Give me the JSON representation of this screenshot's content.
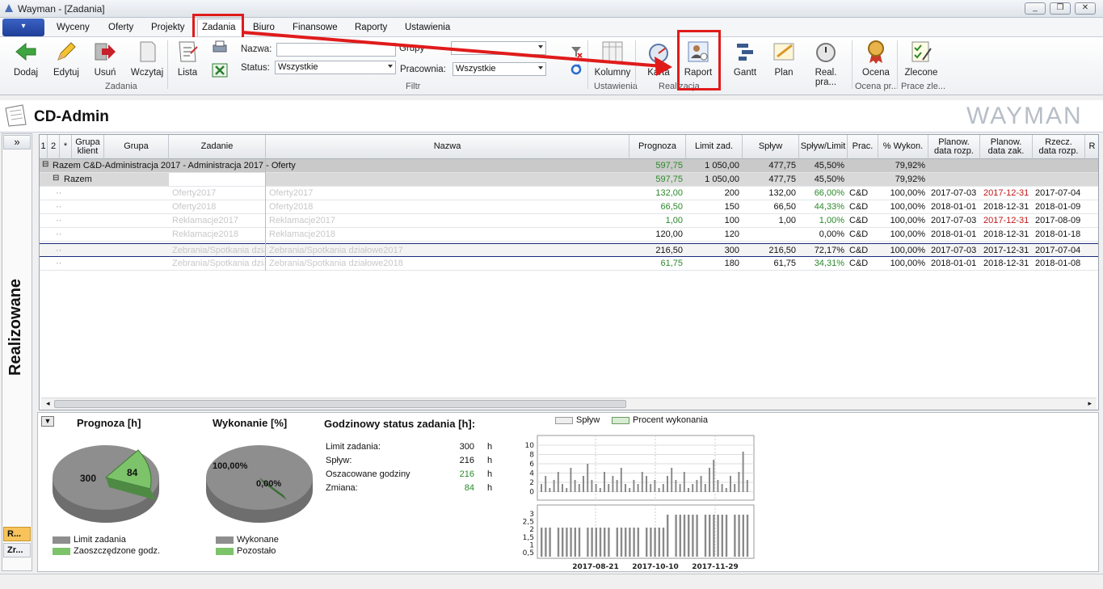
{
  "window": {
    "title": "Wayman - [Zadania]",
    "buttons": [
      "_",
      "❐",
      "✕"
    ]
  },
  "menu": {
    "app_button": "▾",
    "items": [
      "Wyceny",
      "Oferty",
      "Projekty",
      "Zadania",
      "Biuro",
      "Finansowe",
      "Raporty",
      "Ustawienia"
    ]
  },
  "ribbon": {
    "zadania_group": {
      "label": "Zadania",
      "buttons": [
        "Dodaj",
        "Edytuj",
        "Usuń",
        "Wczytaj",
        "Lista"
      ]
    },
    "filter": {
      "label": "Filtr",
      "nazwa_label": "Nazwa:",
      "nazwa_value": "",
      "status_label": "Status:",
      "status_value": "Wszystkie",
      "grupy_label": "Grupy",
      "grupy_value": "",
      "pracownia_label": "Pracownia:",
      "pracownia_value": "Wszystkie"
    },
    "ustawienia_group": {
      "label": "Ustawienia",
      "button": "Kolumny"
    },
    "realizacja_group": {
      "label": "Realizacja",
      "buttons": [
        "Karta",
        "Raport",
        "Gantt",
        "Plan",
        "Real. pra..."
      ]
    },
    "ocena_group": {
      "label": "Ocena pr...",
      "button": "Ocena"
    },
    "prace_group": {
      "label": "Prace zle...",
      "button": "Zlecone"
    }
  },
  "page": {
    "title": "CD-Admin",
    "brand": "WAYMAN",
    "side_label": "Realizowane",
    "side_tabs": [
      "R...",
      "Zr..."
    ],
    "collapse": "»"
  },
  "grid": {
    "columns": [
      "1",
      "2",
      "*",
      "Grupa klient",
      "Grupa",
      "Zadanie",
      "Nazwa",
      "Prognoza",
      "Limit zad.",
      "Spływ",
      "Spływ/Limit",
      "Prac.",
      "% Wykon.",
      "Planow. data rozp.",
      "Planow. data zak.",
      "Rzecz. data rozp.",
      "R"
    ],
    "group_row": {
      "label": "Razem  C&D-Administracja  2017  -  Administracja  2017  -  Oferty",
      "prognoza": "597,75",
      "limit": "1 050,00",
      "splyw": "477,75",
      "splyw_limit": "45,50%",
      "wykon": "79,92%"
    },
    "subgroup_row": {
      "label": "Razem",
      "prognoza": "597,75",
      "limit": "1 050,00",
      "splyw": "477,75",
      "splyw_limit": "45,50%",
      "wykon": "79,92%"
    },
    "rows": [
      {
        "zadanie": "Oferty2017",
        "nazwa": "Oferty2017",
        "prognoza": "132,00",
        "limit": "200",
        "splyw": "132,00",
        "splyw_limit": "66,00%",
        "prac": "C&D",
        "wykon": "100,00%",
        "plan_rozp": "2017-07-03",
        "plan_zak": "2017-12-31",
        "zak_red": true,
        "rzecz_rozp": "2017-07-04"
      },
      {
        "zadanie": "Oferty2018",
        "nazwa": "Oferty2018",
        "prognoza": "66,50",
        "limit": "150",
        "splyw": "66,50",
        "splyw_limit": "44,33%",
        "prac": "C&D",
        "wykon": "100,00%",
        "plan_rozp": "2018-01-01",
        "plan_zak": "2018-12-31",
        "zak_red": false,
        "rzecz_rozp": "2018-01-09"
      },
      {
        "zadanie": "Reklamacje2017",
        "nazwa": "Reklamacje2017",
        "prognoza": "1,00",
        "limit": "100",
        "splyw": "1,00",
        "splyw_limit": "1,00%",
        "prac": "C&D",
        "wykon": "100,00%",
        "plan_rozp": "2017-07-03",
        "plan_zak": "2017-12-31",
        "zak_red": true,
        "rzecz_rozp": "2017-08-09"
      },
      {
        "zadanie": "Reklamacje2018",
        "nazwa": "Reklamacje2018",
        "prognoza": "120,00",
        "limit": "120",
        "splyw": "",
        "splyw_limit": "0,00%",
        "prac": "C&D",
        "wykon": "100,00%",
        "plan_rozp": "2018-01-01",
        "plan_zak": "2018-12-31",
        "zak_red": false,
        "rzecz_rozp": "2018-01-18"
      },
      {
        "zadanie": "Zebrania/Spotkania dzia",
        "nazwa": "Zebrania/Spotkania działowe2017",
        "prognoza": "216,50",
        "limit": "300",
        "splyw": "216,50",
        "splyw_limit": "72,17%",
        "prac": "C&D",
        "wykon": "100,00%",
        "plan_rozp": "2017-07-03",
        "plan_zak": "2017-12-31",
        "zak_red": false,
        "rzecz_rozp": "2017-07-04"
      },
      {
        "zadanie": "Zebrania/Spotkania dzia",
        "nazwa": "Zebrania/Spotkania działowe2018",
        "prognoza": "61,75",
        "limit": "180",
        "splyw": "61,75",
        "splyw_limit": "34,31%",
        "prac": "C&D",
        "wykon": "100,00%",
        "plan_rozp": "2018-01-01",
        "plan_zak": "2018-12-31",
        "zak_red": false,
        "rzecz_rozp": "2018-01-08"
      }
    ]
  },
  "bottom": {
    "prognoza": {
      "title": "Prognoza [h]",
      "big": "300",
      "small": "84",
      "legend": [
        "Limit zadania",
        "Zaoszczędzone godz."
      ]
    },
    "wykonanie": {
      "title": "Wykonanie [%]",
      "big": "100,00%",
      "small": "0,00%",
      "legend": [
        "Wykonane",
        "Pozostało"
      ]
    },
    "status": {
      "title": "Godzinowy status zadania [h]:",
      "unit": "h",
      "rows": [
        {
          "label": "Limit zadania:",
          "value": "300"
        },
        {
          "label": "Spływ:",
          "value": "216"
        },
        {
          "label": "Oszacowane godziny",
          "value": "216",
          "green": true
        },
        {
          "label": "Zmiana:",
          "value": "84",
          "green": true
        }
      ]
    },
    "timeline": {
      "legend": [
        "Spływ",
        "Procent wykonania"
      ],
      "top_ticks": [
        "10",
        "8",
        "6",
        "4",
        "2",
        "0"
      ],
      "bottom_ticks": [
        "3",
        "2,5",
        "2",
        "1,5",
        "1",
        "0,5"
      ],
      "dates": [
        "2017-08-21",
        "2017-10-10",
        "2017-11-29"
      ]
    }
  },
  "colors": {
    "accent_red": "#e01b1b",
    "green": "#2a8a2a",
    "gray_pie": "#8e8e8e",
    "green_pie": "#7cc36a"
  }
}
